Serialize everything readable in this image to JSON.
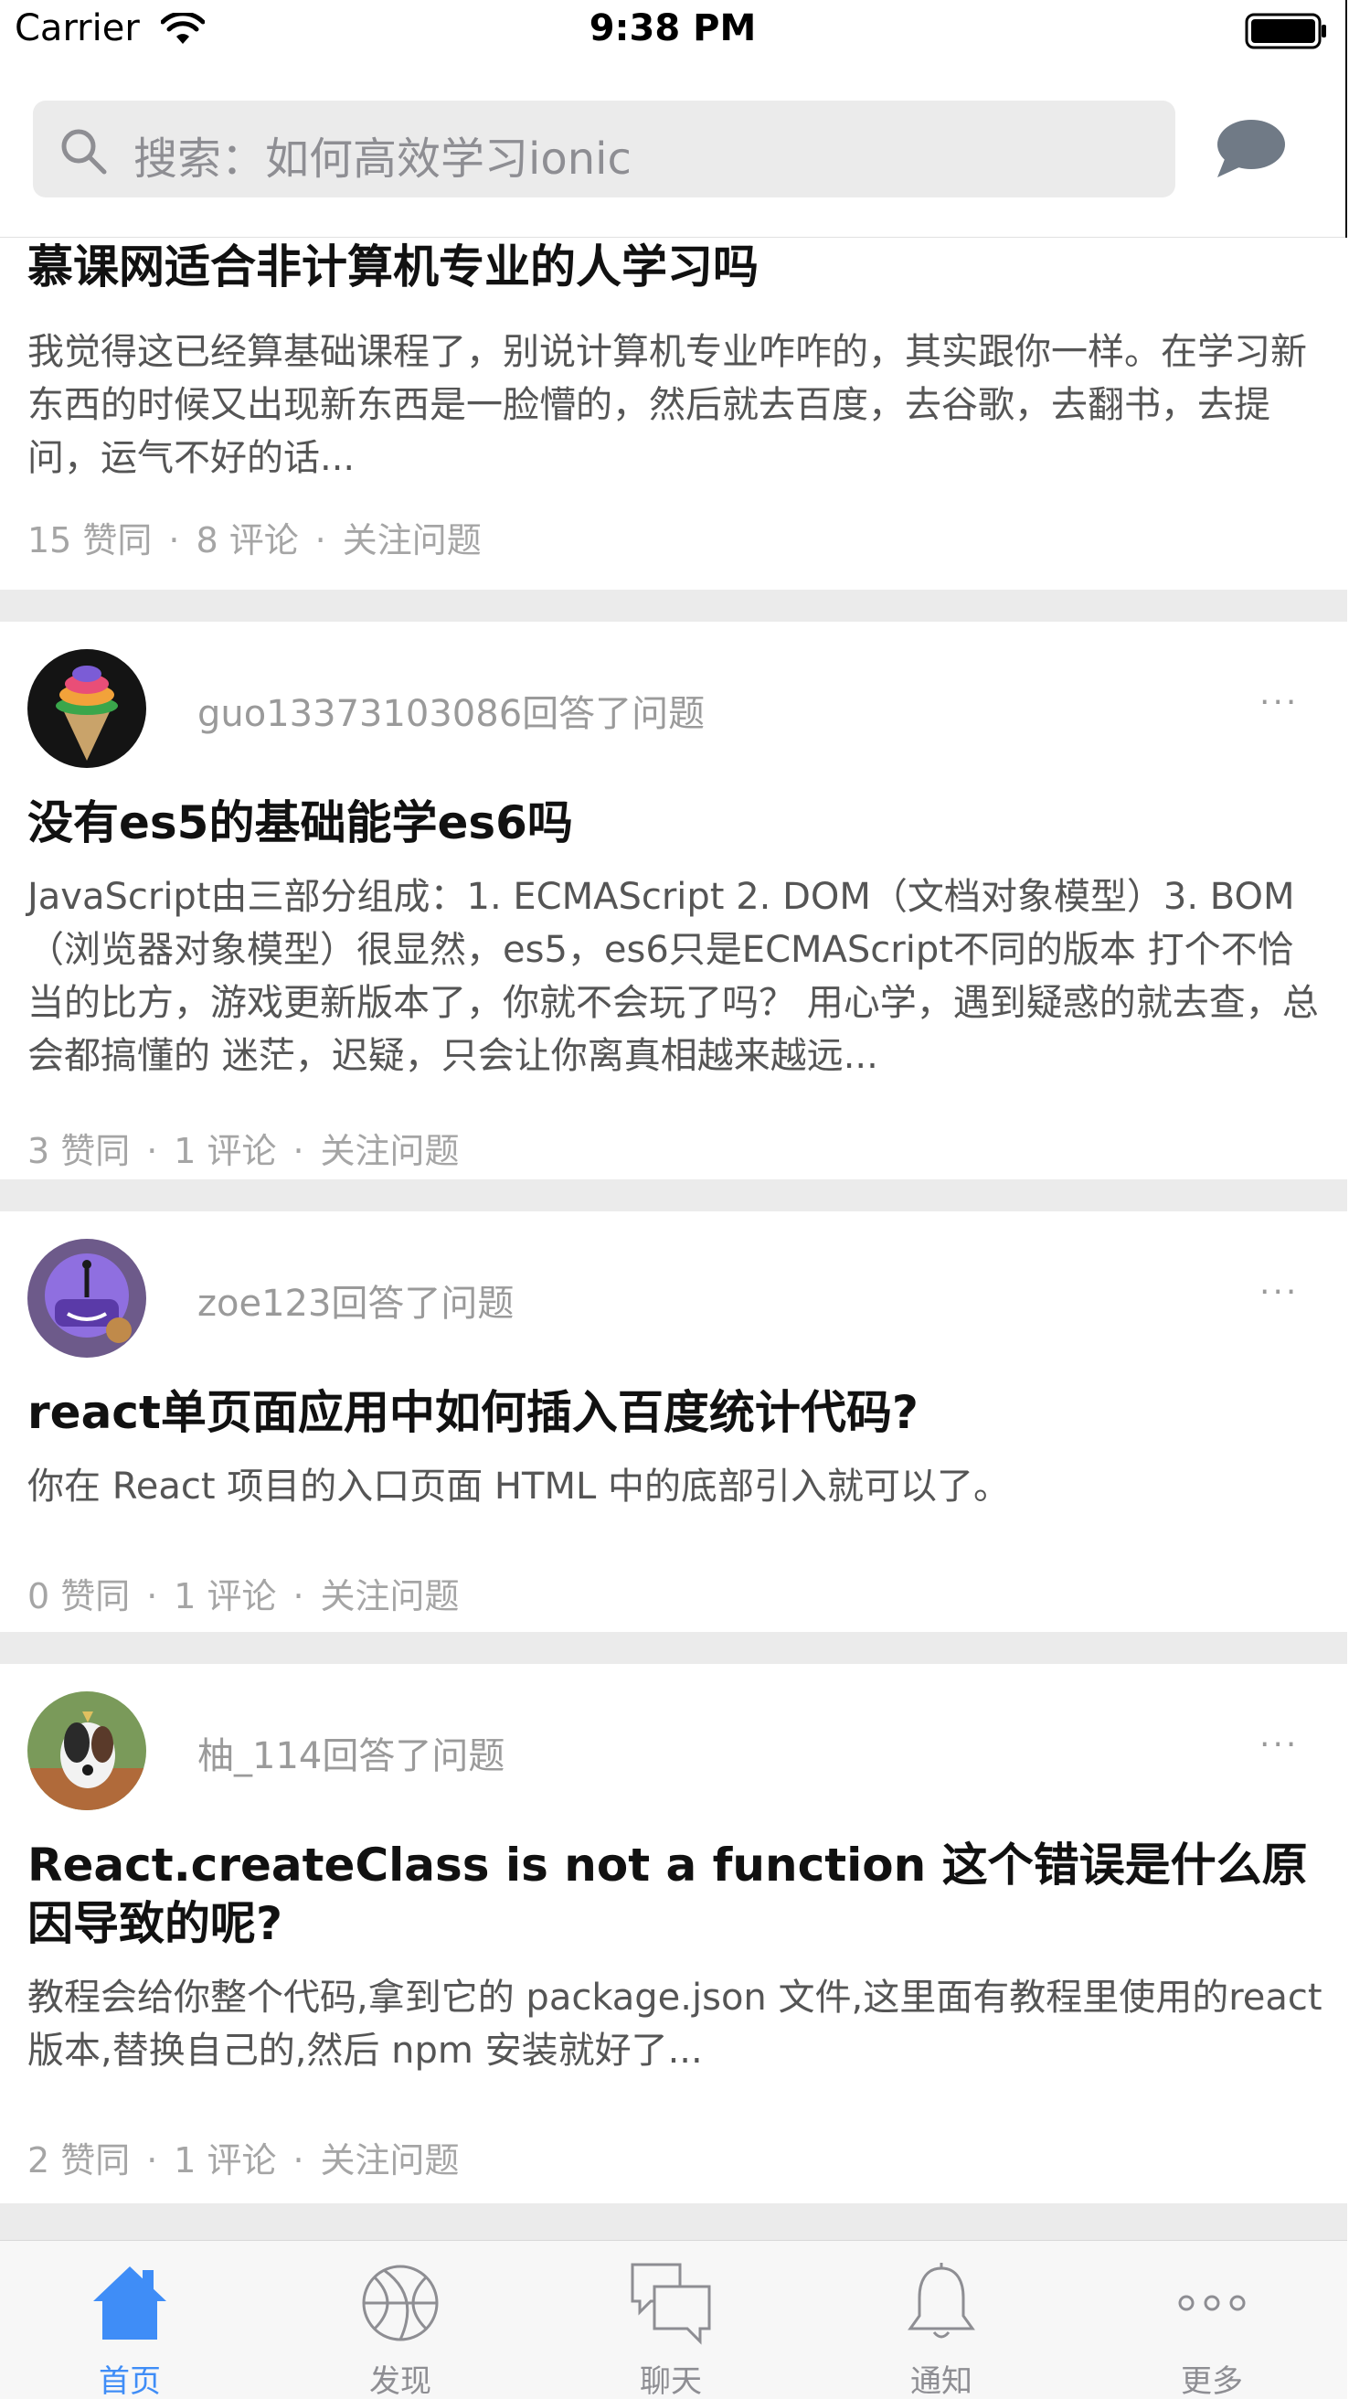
{
  "status_bar": {
    "carrier": "Carrier",
    "time": "9:38 PM"
  },
  "header": {
    "search_placeholder": "搜索：如何高效学习ionic",
    "search_icon": "search-icon",
    "chat_icon": "chat-bubble-icon"
  },
  "feed": [
    {
      "title": "慕课网适合非计算机专业的人学习吗",
      "excerpt": "我觉得这已经算基础课程了，别说计算机专业咋咋的，其实跟你一样。在学习新东西的时候又出现新东西是一脸懵的，然后就去百度，去谷歌，去翻书，去提问，运气不好的话...",
      "likes": "15 赞同",
      "comments": "8  评论",
      "follow": "关注问题",
      "separator": "·"
    },
    {
      "user_line": "guo13373103086回答了问题",
      "more": "···",
      "title": "没有es5的基础能学es6吗",
      "excerpt": "JavaScript由三部分组成：1. ECMAScript 2. DOM（文档对象模型）3. BOM （浏览器对象模型）很显然，es5，es6只是ECMAScript不同的版本 打个不恰当的比方，游戏更新版本了，你就不会玩了吗？ 用心学，遇到疑惑的就去查，总会都搞懂的 迷茫，迟疑，只会让你离真相越来越远...",
      "likes": "3 赞同",
      "comments": "1  评论",
      "follow": "关注问题",
      "separator": "·"
    },
    {
      "user_line": "zoe123回答了问题",
      "more": "···",
      "title": "react单页面应用中如何插入百度统计代码?",
      "excerpt": "你在 React 项目的入口页面 HTML 中的底部引入就可以了。",
      "likes": "0 赞同",
      "comments": "1  评论",
      "follow": "关注问题",
      "separator": "·"
    },
    {
      "user_line": "柚_114回答了问题",
      "more": "···",
      "title": "React.createClass is not a function 这个错误是什么原因导致的呢?",
      "excerpt": "教程会给你整个代码,拿到它的 package.json 文件,这里面有教程里使用的react版本,替换自己的,然后 npm 安装就好了...",
      "likes": "2 赞同",
      "comments": "1  评论",
      "follow": "关注问题",
      "separator": "·"
    }
  ],
  "tabs": [
    {
      "label": "首页",
      "icon": "home-icon",
      "active": true
    },
    {
      "label": "发现",
      "icon": "basketball-icon",
      "active": false
    },
    {
      "label": "聊天",
      "icon": "chat-icon",
      "active": false
    },
    {
      "label": "通知",
      "icon": "bell-icon",
      "active": false
    },
    {
      "label": "更多",
      "icon": "more-icon",
      "active": false
    }
  ],
  "colors": {
    "accent": "#3f8df7",
    "muted": "#9a9a9a",
    "separator": "#ebebeb"
  }
}
